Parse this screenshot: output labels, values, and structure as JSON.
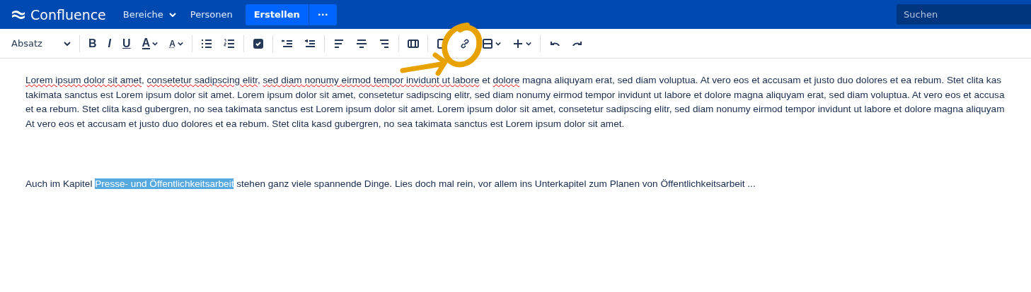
{
  "header": {
    "logo": "Confluence",
    "nav": [
      {
        "label": "Bereiche",
        "dropdown": true
      },
      {
        "label": "Personen",
        "dropdown": false
      }
    ],
    "create_button": "Erstellen",
    "more_button": "···",
    "search": {
      "placeholder": "Suchen"
    }
  },
  "toolbar": {
    "groups": [
      [
        {
          "kind": "select",
          "label": "Absatz"
        }
      ],
      [
        {
          "kind": "bold",
          "label": "B"
        },
        {
          "kind": "italic",
          "label": "I"
        },
        {
          "kind": "underline",
          "label": "U"
        },
        {
          "kind": "color",
          "label": "A"
        },
        {
          "kind": "style",
          "label": "A"
        }
      ],
      [
        {
          "kind": "bullets"
        },
        {
          "kind": "numbers"
        }
      ],
      [
        {
          "kind": "task"
        }
      ],
      [
        {
          "kind": "outdent"
        },
        {
          "kind": "indent"
        }
      ],
      [
        {
          "kind": "align-left"
        },
        {
          "kind": "align-center"
        },
        {
          "kind": "align-right"
        }
      ],
      [
        {
          "kind": "layout"
        }
      ],
      [
        {
          "kind": "table"
        },
        {
          "kind": "link"
        },
        {
          "kind": "image"
        },
        {
          "kind": "insert"
        }
      ],
      [
        {
          "kind": "undo"
        },
        {
          "kind": "redo"
        }
      ]
    ]
  },
  "content": {
    "paragraph": [
      [
        {
          "text": "Lorem ipsum dolor sit amet",
          "misspelled": true
        },
        {
          "text": ", ",
          "misspelled": false
        },
        {
          "text": "consetetur sadipscing elitr",
          "misspelled": true
        },
        {
          "text": ", ",
          "misspelled": false
        },
        {
          "text": "sed diam nonumy eirmod tempor invidunt ut labore",
          "misspelled": true
        },
        {
          "text": " et ",
          "misspelled": false
        },
        {
          "text": "dolore",
          "misspelled": true
        },
        {
          "text": " magna aliquyam erat, sed diam voluptua. At vero eos et accusam et justo duo dolores et ea rebum. Stet clita kas",
          "misspelled": false
        }
      ],
      [
        {
          "text": "takimata sanctus est Lorem ipsum dolor sit amet. Lorem ipsum dolor sit amet, consetetur sadipscing elitr, sed diam nonumy eirmod tempor invidunt ut labore et dolore magna aliquyam erat, sed diam voluptua. At vero eos et accusa",
          "misspelled": false
        }
      ],
      [
        {
          "text": "et ea rebum. Stet clita kasd gubergren, no sea takimata sanctus est Lorem ipsum dolor sit amet. Lorem ipsum dolor sit amet, consetetur sadipscing elitr, sed diam nonumy eirmod tempor invidunt ut labore et dolore magna aliquyam",
          "misspelled": false
        }
      ],
      [
        {
          "text": "At vero eos et accusam et justo duo dolores et ea rebum. Stet clita kasd gubergren, no sea takimata sanctus est Lorem ipsum dolor sit amet.",
          "misspelled": false
        }
      ]
    ],
    "second_paragraph": [
      {
        "text": "Auch im Kapitel ",
        "selected": false
      },
      {
        "text": "Presse- und Öffentlichkeitsarbeit",
        "selected": true
      },
      {
        "text": " stehen ganz viele spannende Dinge. Lies doch mal rein, vor allem ins Unterkapitel zum Planen von Öffentlichkeitsarbeit ...",
        "selected": false
      }
    ]
  }
}
